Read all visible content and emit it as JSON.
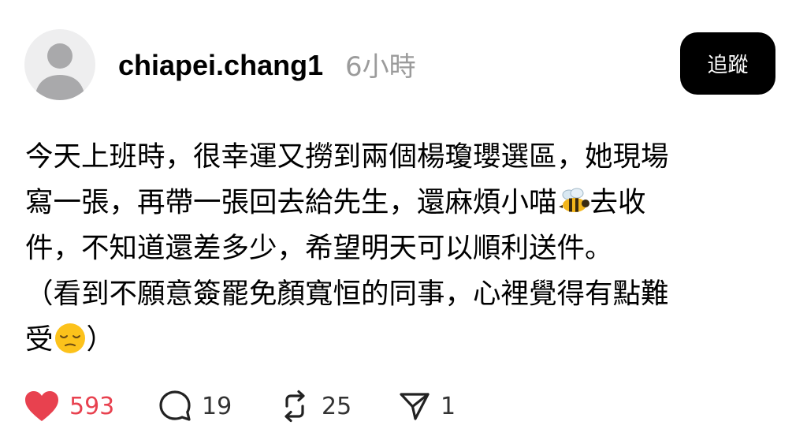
{
  "post": {
    "username": "chiapei.chang1",
    "timestamp": "6小時",
    "follow_label": "追蹤",
    "body_lines": [
      "今天上班時，很幸運又撈到兩個楊瓊瓔選區，她現場",
      "寫一張，再帶一張回去給先生，還麻煩小喵",
      "去收",
      "件，不知道還差多少，希望明天可以順利送件。",
      "（看到不願意簽罷免顏寬恒的同事，心裡覺得有點難",
      "受",
      "）"
    ],
    "emojis": {
      "line2": "bee-emoji",
      "line5": "pensive-face-emoji"
    }
  },
  "actions": {
    "likes": "593",
    "comments": "19",
    "reposts": "25",
    "shares": "1"
  },
  "colors": {
    "like": "#e8414f",
    "button_bg": "#000000",
    "muted": "#9b9b9b"
  }
}
